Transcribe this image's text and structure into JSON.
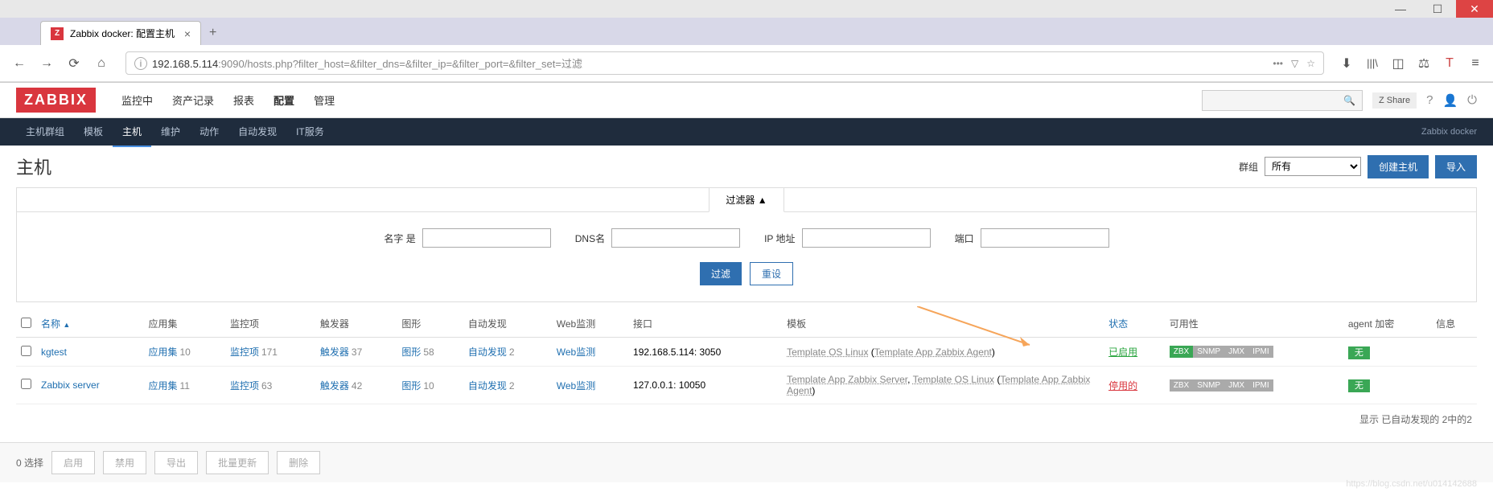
{
  "browser": {
    "tab_title": "Zabbix docker: 配置主机",
    "tab_favicon": "Z",
    "url_host": "192.168.5.114",
    "url_path": ":9090/hosts.php?filter_host=&filter_dns=&filter_ip=&filter_port=&filter_set=过滤"
  },
  "header": {
    "logo": "ZABBIX",
    "main_nav": [
      "监控中",
      "资产记录",
      "报表",
      "配置",
      "管理"
    ],
    "main_nav_active": 3,
    "share": "Share",
    "z_badge": "Z"
  },
  "sub_nav": {
    "items": [
      "主机群组",
      "模板",
      "主机",
      "维护",
      "动作",
      "自动发现",
      "IT服务"
    ],
    "active": 2,
    "right_text": "Zabbix docker"
  },
  "page": {
    "title": "主机",
    "group_label": "群组",
    "group_value": "所有",
    "create_button": "创建主机",
    "import_button": "导入"
  },
  "filter": {
    "tab_label": "过滤器 ▲",
    "name_label": "名字 是",
    "dns_label": "DNS名",
    "ip_label": "IP 地址",
    "port_label": "端口",
    "filter_button": "过滤",
    "reset_button": "重设"
  },
  "table": {
    "headers": {
      "name": "名称",
      "apps": "应用集",
      "items": "监控项",
      "triggers": "触发器",
      "graphs": "图形",
      "discovery": "自动发现",
      "web": "Web监测",
      "interface": "接口",
      "templates": "模板",
      "status": "状态",
      "availability": "可用性",
      "agent_encrypt": "agent 加密",
      "info": "信息"
    },
    "rows": [
      {
        "name": "kgtest",
        "apps": {
          "label": "应用集",
          "count": "10"
        },
        "items": {
          "label": "监控项",
          "count": "171"
        },
        "triggers": {
          "label": "触发器",
          "count": "37"
        },
        "graphs": {
          "label": "图形",
          "count": "58"
        },
        "discovery": {
          "label": "自动发现",
          "count": "2"
        },
        "web": "Web监测",
        "interface": "192.168.5.114: 3050",
        "templates_text": "Template OS Linux (Template App Zabbix Agent)",
        "templates": [
          {
            "text": "Template OS Linux",
            "sep": " ("
          },
          {
            "text": "Template App Zabbix Agent",
            "sep": ")"
          }
        ],
        "status": "已启用",
        "status_class": "enabled",
        "avail": [
          {
            "label": "ZBX",
            "class": "avail-zbx"
          },
          {
            "label": "SNMP",
            "class": "avail-gray"
          },
          {
            "label": "JMX",
            "class": "avail-gray"
          },
          {
            "label": "IPMI",
            "class": "avail-gray"
          }
        ],
        "encrypt": "无"
      },
      {
        "name": "Zabbix server",
        "apps": {
          "label": "应用集",
          "count": "11"
        },
        "items": {
          "label": "监控项",
          "count": "63"
        },
        "triggers": {
          "label": "触发器",
          "count": "42"
        },
        "graphs": {
          "label": "图形",
          "count": "10"
        },
        "discovery": {
          "label": "自动发现",
          "count": "2"
        },
        "web": "Web监测",
        "interface": "127.0.0.1: 10050",
        "templates_text": "Template App Zabbix Server, Template OS Linux (Template App Zabbix Agent)",
        "templates": [
          {
            "text": "Template App Zabbix Server",
            "sep": ", "
          },
          {
            "text": "Template OS Linux",
            "sep": " ("
          },
          {
            "text": "Template App Zabbix Agent",
            "sep": ")"
          }
        ],
        "status": "停用的",
        "status_class": "disabled",
        "avail": [
          {
            "label": "ZBX",
            "class": "avail-gray"
          },
          {
            "label": "SNMP",
            "class": "avail-gray"
          },
          {
            "label": "JMX",
            "class": "avail-gray"
          },
          {
            "label": "IPMI",
            "class": "avail-gray"
          }
        ],
        "encrypt": "无"
      }
    ],
    "footer": "显示 已自动发现的 2中的2"
  },
  "bottom": {
    "selection": "0 选择",
    "enable": "启用",
    "disable": "禁用",
    "export": "导出",
    "mass_update": "批量更新",
    "delete": "删除"
  },
  "watermark": "https://blog.csdn.net/u014142688"
}
